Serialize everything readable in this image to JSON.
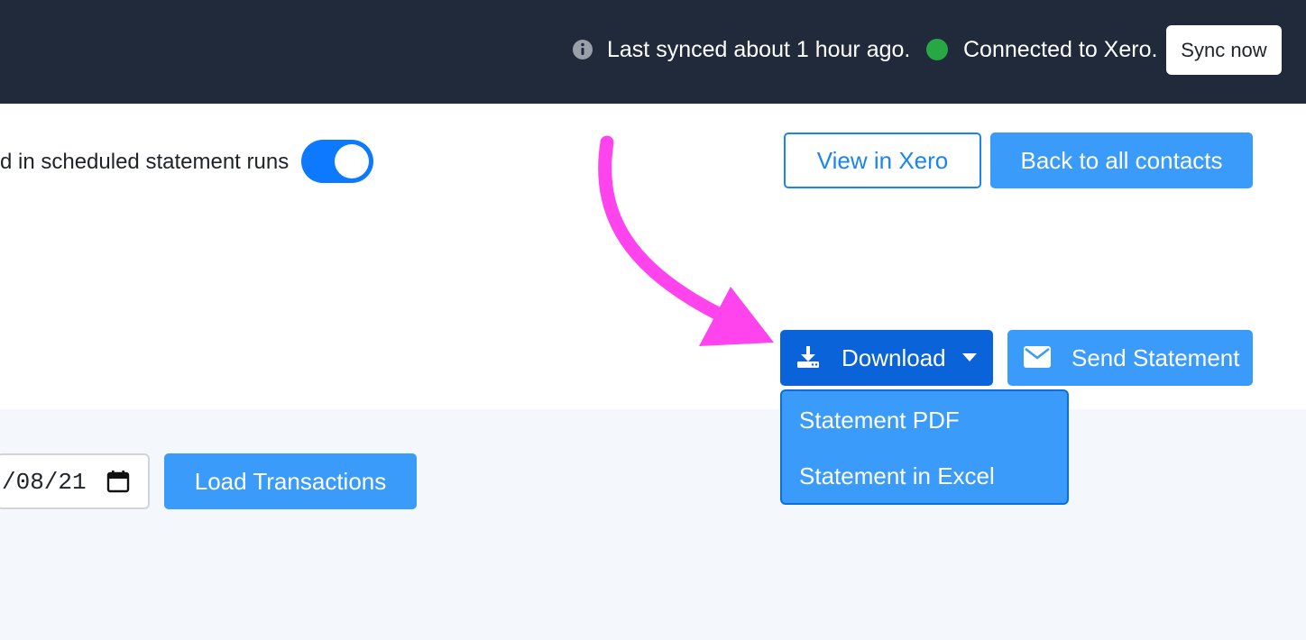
{
  "header": {
    "sync_status": "Last synced about 1 hour ago.",
    "connection_status": "Connected to Xero.",
    "sync_button": "Sync now",
    "status_color": "#28a745",
    "background": "#212a3b"
  },
  "contact": {
    "toggle_label": "d in scheduled statement runs",
    "toggle_on": true,
    "view_in_xero": "View in Xero",
    "back_to_contacts": "Back to all contacts"
  },
  "actions": {
    "download": "Download",
    "send_statement": "Send Statement",
    "download_menu": [
      "Statement PDF",
      "Statement in Excel"
    ]
  },
  "filters": {
    "date_value": "/08/21",
    "load_button": "Load Transactions"
  },
  "annotation": {
    "arrow_color": "#ff44ee"
  },
  "icons": {
    "info": "info-circle-icon",
    "download": "download-icon",
    "send": "envelope-icon",
    "calendar": "calendar-icon",
    "caret": "caret-down-icon"
  }
}
